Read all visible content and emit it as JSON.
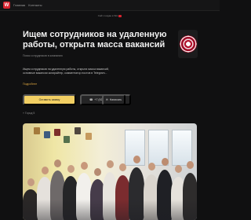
{
  "topbar": {
    "logo_text": "W",
    "nav_links": [
      "Главная",
      "Контакты"
    ]
  },
  "caption_bar": {
    "text": "Сайт создан в Wix"
  },
  "page": {
    "title": "Ищем сотрудников на удаленную работы, открыта масса вакансий",
    "subtitle": "Поиск сотрудников в компанию",
    "description": "Ищем сотрудников на удаленную работы, открыта масса вакансий, основные вакансии копирайтер, комментатор постов в Telegram...",
    "more_link": "Подробнее",
    "location_text": "Город 5",
    "accent_color": "#f2cf63",
    "avatar_color": "#b0102a"
  },
  "actions": {
    "apply_label": "Оставить заявку",
    "call_label": "+7 (925) •• · Показать",
    "message_label": "Написать"
  },
  "icons": {
    "pin": "location-pin-icon",
    "phone": "phone-icon",
    "message": "message-icon"
  }
}
